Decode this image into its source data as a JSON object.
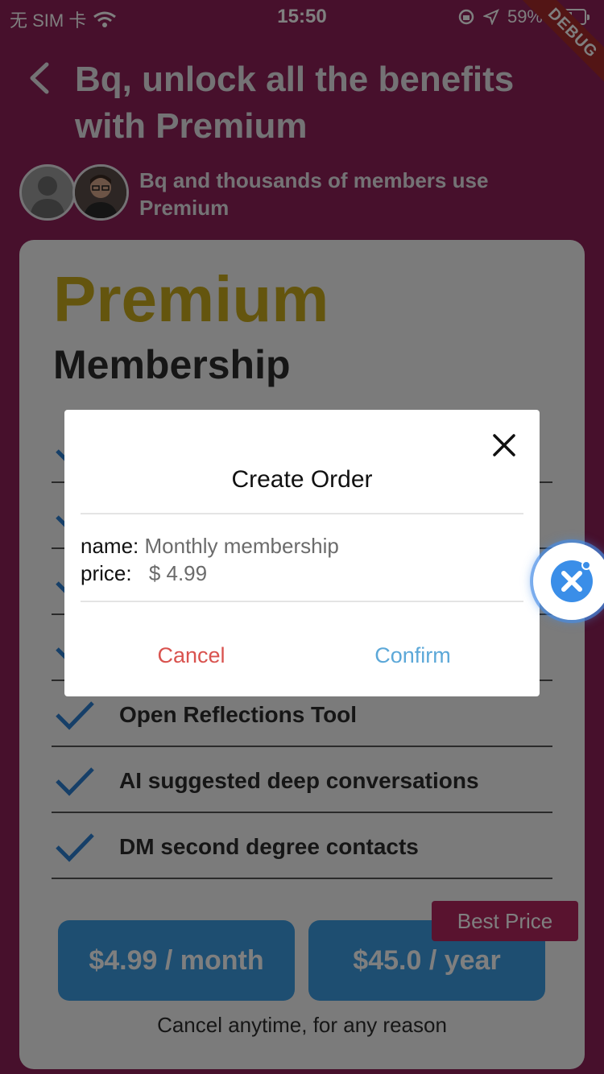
{
  "status_bar": {
    "carrier": "无 SIM 卡",
    "time": "15:50",
    "battery": "59%",
    "debug_label": "DEBUG"
  },
  "header": {
    "title": "Bq, unlock all the benefits with Premium",
    "members_text": "Bq and thousands of members use Premium"
  },
  "card": {
    "title": "Premium",
    "subtitle": "Membership",
    "features": [
      {
        "label": ""
      },
      {
        "label": ""
      },
      {
        "label": ""
      },
      {
        "label": ""
      },
      {
        "label": "Open Reflections Tool"
      },
      {
        "label": "AI suggested deep conversations"
      },
      {
        "label": "DM second degree contacts"
      }
    ],
    "plans": {
      "month": "$4.99 / month",
      "year": "$45.0 / year",
      "badge": "Best Price"
    },
    "footer": "Cancel anytime, for any reason"
  },
  "dialog": {
    "title": "Create Order",
    "name_label": "name:",
    "name_value": "Monthly membership",
    "price_label": "price:",
    "price_value": "$ 4.99",
    "cancel": "Cancel",
    "confirm": "Confirm"
  },
  "colors": {
    "background": "#8e2158",
    "premium_gold": "#c9aa1c",
    "plan_blue": "#3d9ce2",
    "badge_pink": "#b2265f",
    "cancel_red": "#d9534f",
    "confirm_blue": "#5ca8d8"
  },
  "icons": {
    "back": "chevron-left-icon",
    "close": "close-icon",
    "check": "check-icon",
    "fab": "tool-badge-icon"
  }
}
